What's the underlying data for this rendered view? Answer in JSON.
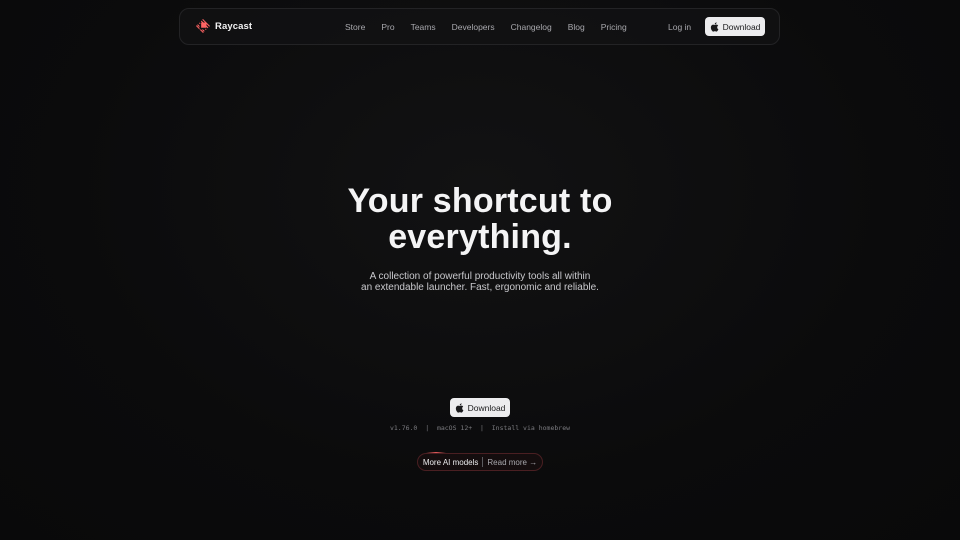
{
  "brand": {
    "name": "Raycast",
    "accent_color": "#ff6363"
  },
  "nav": {
    "links": [
      "Store",
      "Pro",
      "Teams",
      "Developers",
      "Changelog",
      "Blog",
      "Pricing"
    ],
    "login_label": "Log in",
    "download_label": "Download",
    "download_icon": "apple-icon"
  },
  "hero": {
    "title_line1": "Your shortcut to",
    "title_line2": "everything.",
    "subtitle_line1": "A collection of powerful productivity tools all within",
    "subtitle_line2": "an extendable launcher. Fast, ergonomic and reliable.",
    "download_label": "Download",
    "version": "v1.76.0",
    "os_requirement": "macOS 12+",
    "separator": "|",
    "homebrew_label": "Install via homebrew"
  },
  "announcement": {
    "label": "More AI models",
    "link_label": "Read more →"
  }
}
